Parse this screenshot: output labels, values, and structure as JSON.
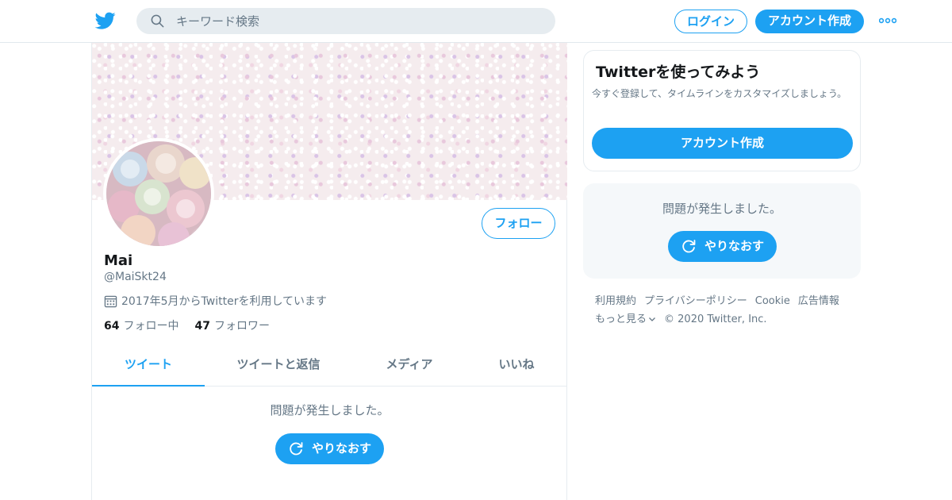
{
  "header": {
    "search_placeholder": "キーワード検索",
    "login_label": "ログイン",
    "signup_label": "アカウント作成"
  },
  "profile": {
    "follow_label": "フォロー",
    "name": "Mai",
    "handle": "@MaiSkt24",
    "joined": "2017年5月からTwitterを利用しています",
    "following_count": "64",
    "following_label": "フォロー中",
    "followers_count": "47",
    "followers_label": "フォロワー"
  },
  "tabs": [
    {
      "label": "ツイート",
      "active": true
    },
    {
      "label": "ツイートと返信",
      "active": false
    },
    {
      "label": "メディア",
      "active": false
    },
    {
      "label": "いいね",
      "active": false
    }
  ],
  "timeline": {
    "error_message": "問題が発生しました。",
    "retry_label": "やりなおす"
  },
  "sidebar": {
    "signup_card": {
      "title": "Twitterを使ってみよう",
      "description": "今すぐ登録して、タイムラインをカスタマイズしましょう。",
      "button_label": "アカウント作成"
    },
    "error_card": {
      "message": "問題が発生しました。",
      "retry_label": "やりなおす"
    },
    "footer": {
      "links": [
        "利用規約",
        "プライバシーポリシー",
        "Cookie",
        "広告情報"
      ],
      "more_label": "もっと見る",
      "copyright": "© 2020 Twitter, Inc."
    }
  },
  "colors": {
    "accent": "#1da1f2",
    "text_secondary": "#657786",
    "search_bg": "#e6ecf0"
  },
  "icons": {
    "logo": "twitter-bird-icon",
    "search": "search-icon",
    "more": "more-dots-icon",
    "calendar": "calendar-icon",
    "retry": "refresh-icon",
    "more_chevron": "chevron-down-icon"
  }
}
